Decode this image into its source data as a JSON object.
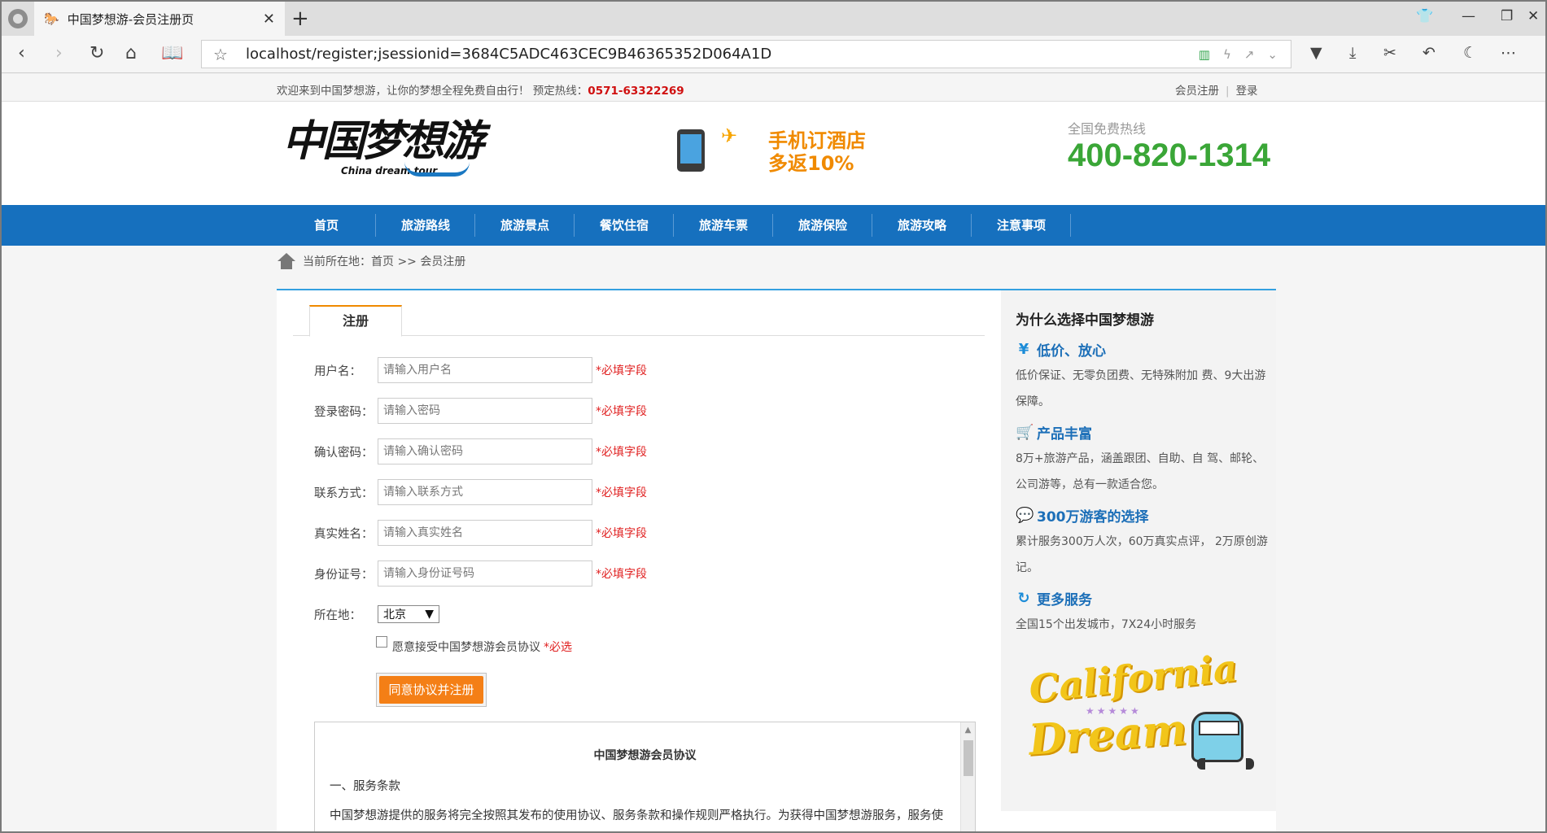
{
  "browser": {
    "tab_title": "中国梦想游-会员注册页",
    "url": "localhost/register;jsessionid=3684C5ADC463CEC9B46365352D064A1D"
  },
  "topbar": {
    "welcome": "欢迎来到中国梦想游，让你的梦想全程免费自由行！ 预定热线：",
    "hotline": "0571-63322269",
    "register_link": "会员注册",
    "login_link": "登录"
  },
  "header": {
    "logo_cn": "中国梦想游",
    "logo_en": "China dream tour",
    "promo_line1": "手机订酒店",
    "promo_line2": "多返10%",
    "hotline_label": "全国免费热线",
    "hotline_number": "400-820-1314"
  },
  "nav": [
    "首页",
    "旅游路线",
    "旅游景点",
    "餐饮住宿",
    "旅游车票",
    "旅游保险",
    "旅游攻略",
    "注意事项"
  ],
  "breadcrumb": "当前所在地：首页 >> 会员注册",
  "form": {
    "tab_label": "注册",
    "required_text": "*必填字段",
    "fields": [
      {
        "label": "用户名：",
        "placeholder": "请输入用户名"
      },
      {
        "label": "登录密码：",
        "placeholder": "请输入密码"
      },
      {
        "label": "确认密码：",
        "placeholder": "请输入确认密码"
      },
      {
        "label": "联系方式：",
        "placeholder": "请输入联系方式"
      },
      {
        "label": "真实姓名：",
        "placeholder": "请输入真实姓名"
      },
      {
        "label": "身份证号：",
        "placeholder": "请输入身份证号码"
      }
    ],
    "location_label": "所在地：",
    "location_value": "北京",
    "agree_text": "愿意接受中国梦想游会员协议",
    "agree_required": "*必选",
    "submit_label": "同意协议并注册"
  },
  "agreement": {
    "title": "中国梦想游会员协议",
    "section": "一、服务条款",
    "text": "中国梦想游提供的服务将完全按照其发布的使用协议、服务条款和操作规则严格执行。为获得中国梦想游服务，服务使用人（以下称“会员”）应当同意本协议的全部条款并按照页面上的提示完成全部的注册程序。"
  },
  "sidebar": {
    "title": "为什么选择中国梦想游",
    "features": [
      {
        "icon": "yen-icon",
        "glyph": "¥",
        "title": "低价、放心",
        "desc": "低价保证、无零负团费、无特殊附加 费、9大出游保障。"
      },
      {
        "icon": "cart-icon",
        "glyph": "🛒",
        "title": "产品丰富",
        "desc": "8万+旅游产品，涵盖跟团、自助、自 驾、邮轮、公司游等，总有一款适合您。"
      },
      {
        "icon": "chat-icon",
        "glyph": "💬",
        "title": "300万游客的选择",
        "desc": "累计服务300万人次，60万真实点评， 2万原创游记。"
      },
      {
        "icon": "service-24-icon",
        "glyph": "↻",
        "title": "更多服务",
        "desc": "全国15个出发城市，7X24小时服务"
      }
    ],
    "banner_line1": "California",
    "banner_line2": "Dream"
  },
  "colors": {
    "nav": "#1670be",
    "accent": "#f08a00",
    "required": "#e02020",
    "hotline": "#3aa637",
    "link_blue": "#1c6fb8"
  }
}
